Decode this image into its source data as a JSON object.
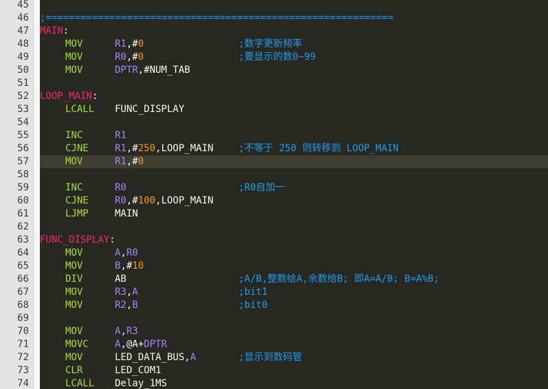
{
  "editor": {
    "colors": {
      "background": "#272822",
      "gutter": "#e4e4e4",
      "label": "#f92672",
      "keyword": "#a6e22e",
      "comment": "#1f9cf0",
      "number": "#fd971f",
      "register": "#ae81ff",
      "text": "#f8f8f2",
      "current_line": "#3e3d32"
    },
    "current_line": 57,
    "lines": [
      {
        "n": "45",
        "segs": []
      },
      {
        "n": "46",
        "segs": [
          {
            "t": ";============================================================",
            "c": "comm",
            "col": "all"
          }
        ]
      },
      {
        "n": "47",
        "segs": [
          {
            "t": "MAIN",
            "c": "label",
            "col": "all"
          },
          {
            "t": ":",
            "c": "punct",
            "col": "all2"
          }
        ]
      },
      {
        "n": "48",
        "op": "MOV",
        "args": [
          {
            "t": "R1",
            "c": "reg"
          },
          {
            "t": ",#",
            "c": "plain"
          },
          {
            "t": "0",
            "c": "num"
          }
        ],
        "cm": ";数字更新频率"
      },
      {
        "n": "49",
        "op": "MOV",
        "args": [
          {
            "t": "R0",
            "c": "reg"
          },
          {
            "t": ",#",
            "c": "plain"
          },
          {
            "t": "0",
            "c": "num"
          }
        ],
        "cm": ";要显示的数0~99"
      },
      {
        "n": "50",
        "op": "MOV",
        "args": [
          {
            "t": "DPTR",
            "c": "reg"
          },
          {
            "t": ",#NUM_TAB",
            "c": "plain"
          }
        ],
        "cm": ""
      },
      {
        "n": "51",
        "segs": []
      },
      {
        "n": "52",
        "segs": [
          {
            "t": "LOOP_MAIN",
            "c": "label",
            "col": "all"
          },
          {
            "t": ":",
            "c": "punct",
            "col": "all2"
          }
        ]
      },
      {
        "n": "53",
        "op": "LCALL",
        "args": [
          {
            "t": "FUNC_DISPLAY",
            "c": "plain"
          }
        ],
        "cm": ""
      },
      {
        "n": "54",
        "segs": []
      },
      {
        "n": "55",
        "op": "INC",
        "args": [
          {
            "t": "R1",
            "c": "reg"
          }
        ],
        "cm": ""
      },
      {
        "n": "56",
        "op": "CJNE",
        "args": [
          {
            "t": "R1",
            "c": "reg"
          },
          {
            "t": ",#",
            "c": "plain"
          },
          {
            "t": "250",
            "c": "num"
          },
          {
            "t": ",LOOP_MAIN",
            "c": "plain"
          }
        ],
        "cm": ";不等于 250 则转移到 LOOP_MAIN"
      },
      {
        "n": "57",
        "op": "MOV",
        "args": [
          {
            "t": "R1",
            "c": "reg"
          },
          {
            "t": ",#",
            "c": "plain"
          },
          {
            "t": "0",
            "c": "num"
          }
        ],
        "cm": ""
      },
      {
        "n": "58",
        "segs": []
      },
      {
        "n": "59",
        "op": "INC",
        "args": [
          {
            "t": "R0",
            "c": "reg"
          }
        ],
        "cm": ";R0自加一"
      },
      {
        "n": "60",
        "op": "CJNE",
        "args": [
          {
            "t": "R0",
            "c": "reg"
          },
          {
            "t": ",#",
            "c": "plain"
          },
          {
            "t": "100",
            "c": "num"
          },
          {
            "t": ",LOOP_MAIN",
            "c": "plain"
          }
        ],
        "cm": ""
      },
      {
        "n": "61",
        "op": "LJMP",
        "args": [
          {
            "t": "MAIN",
            "c": "plain"
          }
        ],
        "cm": ""
      },
      {
        "n": "62",
        "segs": []
      },
      {
        "n": "63",
        "segs": [
          {
            "t": "FUNC_DISPLAY",
            "c": "label",
            "col": "all"
          },
          {
            "t": ":",
            "c": "punct",
            "col": "all2"
          }
        ]
      },
      {
        "n": "64",
        "op": "MOV",
        "args": [
          {
            "t": "A",
            "c": "reg"
          },
          {
            "t": ",",
            "c": "plain"
          },
          {
            "t": "R0",
            "c": "reg"
          }
        ],
        "cm": ""
      },
      {
        "n": "65",
        "op": "MOV",
        "args": [
          {
            "t": "B",
            "c": "reg"
          },
          {
            "t": ",#",
            "c": "plain"
          },
          {
            "t": "10",
            "c": "num"
          }
        ],
        "cm": ""
      },
      {
        "n": "66",
        "op": "DIV",
        "args": [
          {
            "t": "AB",
            "c": "plain"
          }
        ],
        "cm": ";A/B,整数给A,余数给B; 即A=A/B; B=A%B;"
      },
      {
        "n": "67",
        "op": "MOV",
        "args": [
          {
            "t": "R3",
            "c": "reg"
          },
          {
            "t": ",",
            "c": "plain"
          },
          {
            "t": "A",
            "c": "reg"
          }
        ],
        "cm": ";bit1"
      },
      {
        "n": "68",
        "op": "MOV",
        "args": [
          {
            "t": "R2",
            "c": "reg"
          },
          {
            "t": ",",
            "c": "plain"
          },
          {
            "t": "B",
            "c": "reg"
          }
        ],
        "cm": ";bit0"
      },
      {
        "n": "69",
        "segs": []
      },
      {
        "n": "70",
        "op": "MOV",
        "args": [
          {
            "t": "A",
            "c": "reg"
          },
          {
            "t": ",",
            "c": "plain"
          },
          {
            "t": "R3",
            "c": "reg"
          }
        ],
        "cm": ""
      },
      {
        "n": "71",
        "op": "MOVC",
        "args": [
          {
            "t": "A",
            "c": "reg"
          },
          {
            "t": ",@A+",
            "c": "plain"
          },
          {
            "t": "DPTR",
            "c": "reg"
          }
        ],
        "cm": ""
      },
      {
        "n": "72",
        "op": "MOV",
        "args": [
          {
            "t": "LED_DATA_BUS",
            "c": "plain"
          },
          {
            "t": ",",
            "c": "plain"
          },
          {
            "t": "A",
            "c": "reg"
          }
        ],
        "cm": ";显示到数码管"
      },
      {
        "n": "73",
        "op": "CLR",
        "args": [
          {
            "t": "LED_COM1",
            "c": "plain"
          }
        ],
        "cm": ""
      },
      {
        "n": "74",
        "op": "LCALL",
        "args": [
          {
            "t": "Delay_1MS",
            "c": "plain"
          }
        ],
        "cm": ""
      }
    ]
  }
}
